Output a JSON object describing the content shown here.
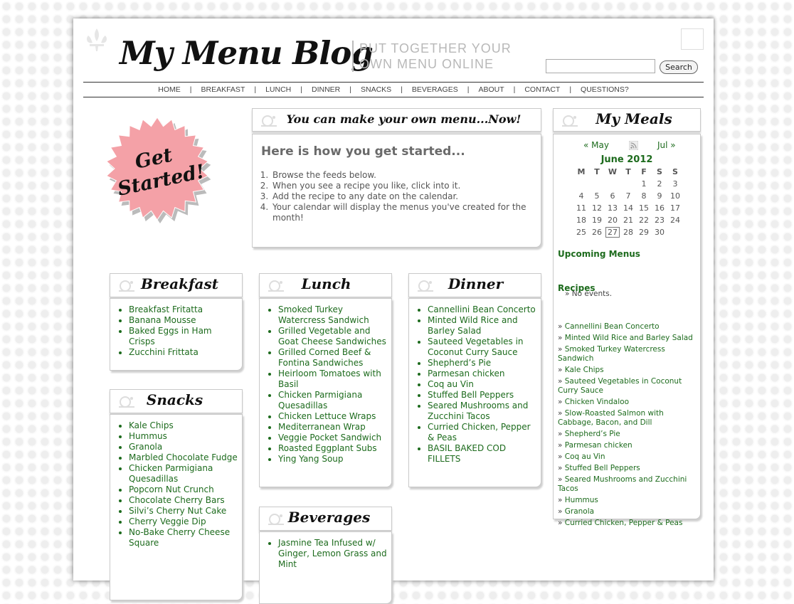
{
  "header": {
    "logo": "My Menu Blog",
    "tagline_line1": "PUT TOGETHER YOUR",
    "tagline_line2": "OWN MENU ONLINE",
    "search_value": "",
    "search_button": "Search"
  },
  "nav": [
    "HOME",
    "BREAKFAST",
    "LUNCH",
    "DINNER",
    "SNACKS",
    "BEVERAGES",
    "ABOUT",
    "CONTACT",
    "QUESTIONS?"
  ],
  "badge": {
    "line1": "Get",
    "line2": "Started!",
    "color": "#f4a1a7"
  },
  "intro": {
    "header": "You can make your own menu...Now!",
    "title": "Here is how you get started...",
    "steps": [
      "Browse the feeds below.",
      "When you see a recipe you like, click into it.",
      "Add the recipe to any date on the calendar.",
      "Your calendar will display the menus you've created for the month!"
    ]
  },
  "breakfast": {
    "title": "Breakfast",
    "items": [
      "Breakfast Fritatta",
      "Banana Mousse",
      "Baked Eggs in Ham Crisps",
      "Zucchini Frittata"
    ]
  },
  "lunch": {
    "title": "Lunch",
    "items": [
      "Smoked Turkey Watercress Sandwich",
      "Grilled Vegetable and Goat Cheese Sandwiches",
      "Grilled Corned Beef & Fontina Sandwiches",
      "Heirloom Tomatoes with Basil",
      "Chicken Parmigiana Quesadillas",
      "Chicken Lettuce Wraps",
      "Mediterranean Wrap",
      "Veggie Pocket Sandwich",
      "Roasted Eggplant Subs",
      "Ying Yang Soup"
    ]
  },
  "dinner": {
    "title": "Dinner",
    "items": [
      "Cannellini Bean Concerto",
      "Minted Wild Rice and Barley Salad",
      "Sauteed Vegetables in Coconut Curry Sauce",
      "Shepherd’s Pie",
      "Parmesan chicken",
      "Coq au Vin",
      "Stuffed Bell Peppers",
      "Seared Mushrooms and Zucchini Tacos",
      "Curried Chicken, Pepper & Peas",
      "BASIL BAKED COD FILLETS"
    ]
  },
  "snacks": {
    "title": "Snacks",
    "items": [
      "Kale Chips",
      "Hummus",
      "Granola",
      "Marbled Chocolate Fudge",
      "Chicken Parmigiana Quesadillas",
      "Popcorn Nut Crunch",
      "Chocolate Cherry Bars",
      "Silvi’s Cherry Nut Cake",
      "Cherry Veggie Dip",
      "No-Bake Cherry Cheese Square"
    ]
  },
  "beverages": {
    "title": "Beverages",
    "items": [
      "Jasmine Tea Infused w/ Ginger, Lemon Grass and Mint"
    ]
  },
  "sidebar": {
    "title": "My Meals",
    "prev": "« May",
    "next": "Jul »",
    "month": "June 2012",
    "weekdays": [
      "M",
      "T",
      "W",
      "T",
      "F",
      "S",
      "S"
    ],
    "weeks": [
      [
        "",
        "",
        "",
        "",
        "1",
        "2",
        "3"
      ],
      [
        "4",
        "5",
        "6",
        "7",
        "8",
        "9",
        "10"
      ],
      [
        "11",
        "12",
        "13",
        "14",
        "15",
        "16",
        "17"
      ],
      [
        "18",
        "19",
        "20",
        "21",
        "22",
        "23",
        "24"
      ],
      [
        "25",
        "26",
        "27",
        "28",
        "29",
        "30",
        ""
      ]
    ],
    "today": "27",
    "upcoming_title": "Upcoming Menus",
    "upcoming_empty": "No events.",
    "recipes_title": "Recipes",
    "recipes": [
      "Cannellini Bean Concerto",
      "Minted Wild Rice and Barley Salad",
      "Smoked Turkey Watercress Sandwich",
      "Kale Chips",
      "Sauteed Vegetables in Coconut Curry Sauce",
      "Chicken Vindaloo",
      "Slow-Roasted Salmon with Cabbage, Bacon, and Dill",
      "Shepherd’s Pie",
      "Parmesan chicken",
      "Coq au Vin",
      "Stuffed Bell Peppers",
      "Seared Mushrooms and Zucchini Tacos",
      "Hummus",
      "Granola",
      "Curried Chicken, Pepper & Peas"
    ]
  },
  "colors": {
    "link_green": "#1d6b1d",
    "border_gray": "#c9c9c9"
  }
}
